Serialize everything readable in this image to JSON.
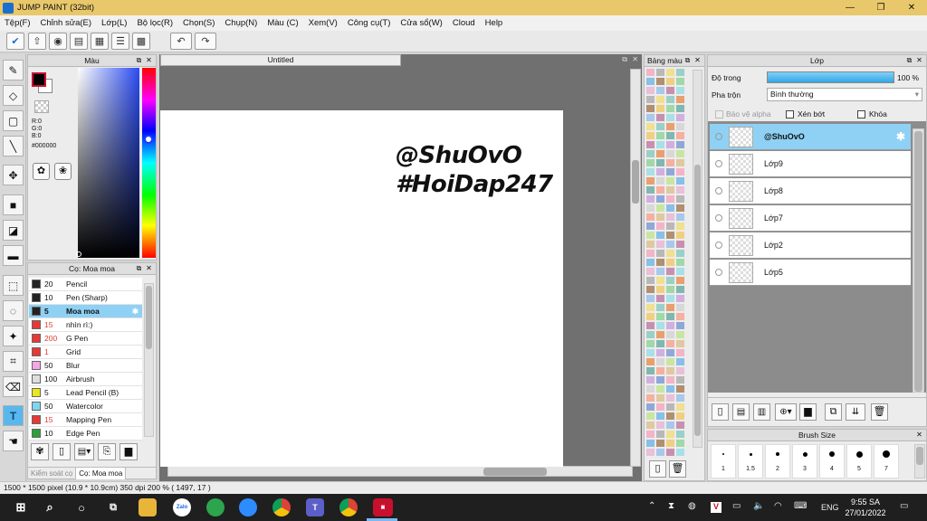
{
  "window": {
    "title": "JUMP PAINT (32bit)",
    "minimize": "—",
    "restore": "❐",
    "close": "✕"
  },
  "menu": [
    "Tệp(F)",
    "Chỉnh sửa(E)",
    "Lớp(L)",
    "Bộ lọc(R)",
    "Chọn(S)",
    "Chụp(N)",
    "Màu (C)",
    "Xem(V)",
    "Công cụ(T)",
    "Cửa sổ(W)",
    "Cloud",
    "Help"
  ],
  "color_panel": {
    "title": "Màu",
    "r": "R:0",
    "g": "G:0",
    "b": "B:0",
    "hex": "#000000"
  },
  "brush_panel": {
    "title": "Cọ: Moa moa",
    "brushes": [
      {
        "size": "20",
        "name": "Pencil",
        "color": "#222222"
      },
      {
        "size": "10",
        "name": "Pen (Sharp)",
        "color": "#222222"
      },
      {
        "size": "5",
        "name": "Moa moa",
        "color": "#222222",
        "selected": true
      },
      {
        "size": "15",
        "name": "nhìn rì:)",
        "color": "#e53935"
      },
      {
        "size": "200",
        "name": "G Pen",
        "color": "#e53935"
      },
      {
        "size": "1",
        "name": "Grid",
        "color": "#e53935"
      },
      {
        "size": "50",
        "name": "Blur",
        "color": "#f4a6e6"
      },
      {
        "size": "100",
        "name": "Airbrush",
        "color": "#dddddd"
      },
      {
        "size": "5",
        "name": "Lead Pencil (B)",
        "color": "#e8e81a"
      },
      {
        "size": "50",
        "name": "Watercolor",
        "color": "#7ed6f5"
      },
      {
        "size": "15",
        "name": "Mapping Pen",
        "color": "#e53935"
      },
      {
        "size": "10",
        "name": "Edge Pen",
        "color": "#2e9e3a"
      }
    ],
    "tabs": [
      "Kiểm soát cọ",
      "Cọ: Moa moa"
    ]
  },
  "canvas": {
    "tab": "Untitled",
    "text_line1": "@ShuOvO",
    "text_line2": "#HoiDap247"
  },
  "swatch_panel": {
    "title": "Bảng màu"
  },
  "layer_panel": {
    "title": "Lớp",
    "opacity_label": "Độ trong",
    "opacity_value": "100 %",
    "opacity_fraction": 1.0,
    "blend_label": "Pha trộn",
    "blend_value": "Bình thường",
    "protect_alpha": "Bảo vệ alpha",
    "clipping": "Xén bớt",
    "lock": "Khóa",
    "layers": [
      {
        "name": "@ShuOvO",
        "selected": true
      },
      {
        "name": "Lớp9"
      },
      {
        "name": "Lớp8"
      },
      {
        "name": "Lớp7"
      },
      {
        "name": "Lớp2"
      },
      {
        "name": "Lớp5"
      }
    ]
  },
  "brush_size": {
    "title": "Brush Size",
    "sizes": [
      "1",
      "1.5",
      "2",
      "3",
      "4",
      "5",
      "7"
    ]
  },
  "status": {
    "text": "1500 * 1500 pixel   (10.9 * 10.9cm)   350 dpi   200 %   ( 1497, 17 )"
  },
  "taskbar": {
    "lang": "ENG",
    "time": "9:55 SA",
    "date": "27/01/2022",
    "zalo": "Zalo",
    "teams": "T"
  }
}
